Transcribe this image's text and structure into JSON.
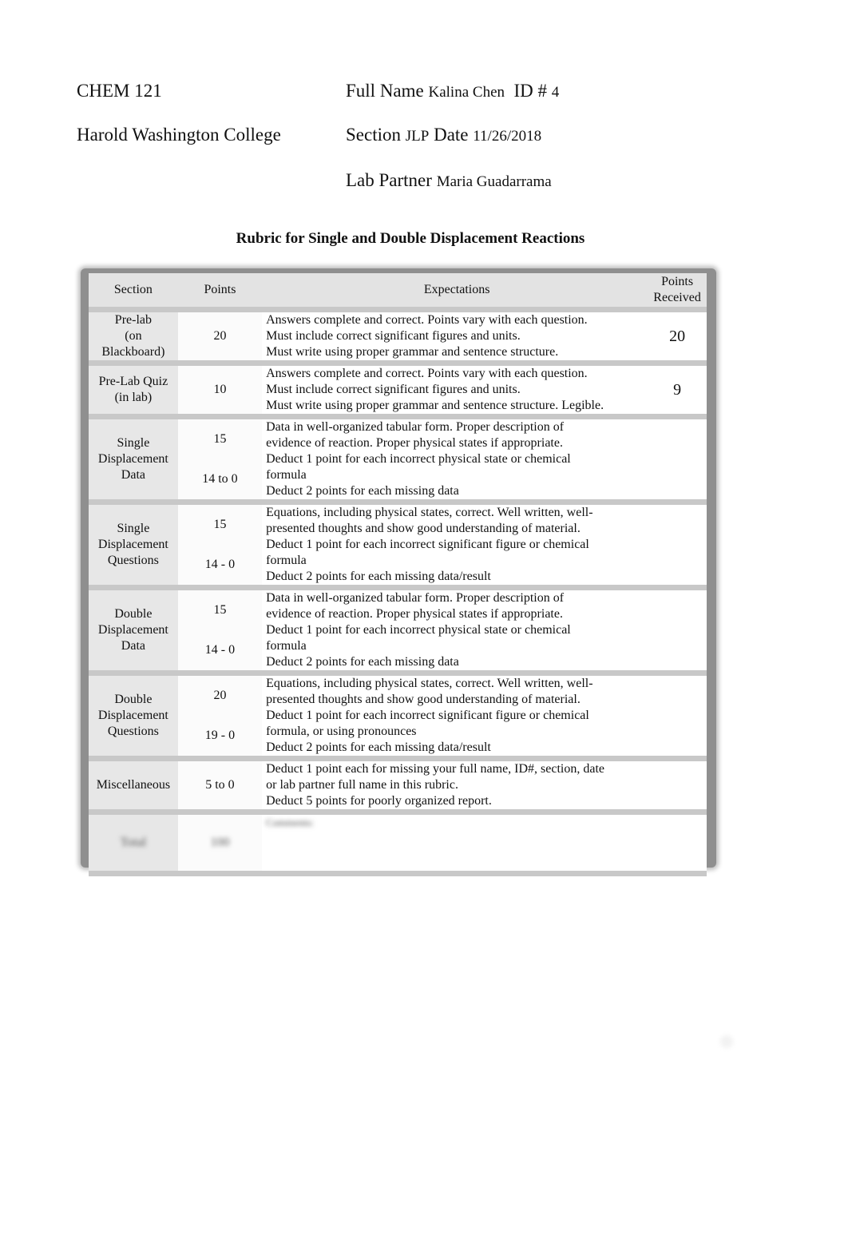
{
  "header": {
    "course": "CHEM 121",
    "college": "Harold Washington College",
    "full_name_label": "Full Name",
    "full_name_value": "Kalina Chen",
    "id_label": "ID #",
    "id_value": "4",
    "section_label": "Section",
    "section_value": "JLP",
    "date_label": "Date",
    "date_value": "11/26/2018",
    "lab_partner_label": "Lab Partner",
    "lab_partner_value": "Maria Guadarrama"
  },
  "title": "Rubric for Single and Double Displacement Reactions",
  "table": {
    "headers": {
      "section": "Section",
      "points": "Points",
      "expectations": "Expectations",
      "received_line1": "Points",
      "received_line2": "Received"
    },
    "rows": [
      {
        "section": [
          "Pre-lab",
          "(on",
          "Blackboard)"
        ],
        "points": [
          "20"
        ],
        "expectations": [
          "Answers complete and correct. Points vary with each question.",
          "Must include correct significant figures and units.",
          "Must write using proper grammar and sentence structure."
        ],
        "received": "20"
      },
      {
        "section": [
          "Pre-Lab Quiz",
          "(in lab)"
        ],
        "points": [
          "10"
        ],
        "expectations": [
          "Answers complete and correct.  Points vary with each question.",
          "Must include correct significant figures and units.",
          "Must write using proper grammar and sentence structure. Legible."
        ],
        "received": "9"
      },
      {
        "section": [
          "Single",
          "Displacement",
          "Data"
        ],
        "points": [
          "15",
          "14 to 0"
        ],
        "expectations": [
          "Data in well-organized tabular form. Proper description of",
          "evidence of reaction.  Proper physical states if appropriate.",
          "Deduct 1 point for each incorrect physical state or chemical",
          "formula",
          "Deduct 2 points for each missing data"
        ],
        "received": ""
      },
      {
        "section": [
          "Single",
          "Displacement",
          "Questions"
        ],
        "points": [
          "15",
          "14 - 0"
        ],
        "expectations": [
          "Equations, including physical states, correct.  Well written, well-",
          "presented thoughts and show good understanding of material.",
          "Deduct 1 point for each incorrect significant figure or chemical",
          "formula",
          "Deduct 2 points for each missing data/result"
        ],
        "received": ""
      },
      {
        "section": [
          "Double",
          "Displacement",
          "Data"
        ],
        "points": [
          "15",
          "14 - 0"
        ],
        "expectations": [
          "Data in well-organized tabular form. Proper description of",
          "evidence of reaction.  Proper physical states if appropriate.",
          "Deduct 1 point for each incorrect physical state or chemical",
          "formula",
          "Deduct 2 points for each missing data"
        ],
        "received": ""
      },
      {
        "section": [
          "Double",
          "Displacement",
          "Questions"
        ],
        "points": [
          "20",
          "19 - 0"
        ],
        "expectations": [
          "Equations, including physical states, correct.  Well written, well-",
          "presented thoughts and show good understanding of material.",
          "Deduct 1 point for each incorrect significant figure or chemical",
          "formula, or using pronounces",
          "Deduct 2 points for each missing data/result"
        ],
        "received": ""
      },
      {
        "section": [
          "Miscellaneous"
        ],
        "points": [
          "5 to 0"
        ],
        "expectations": [
          "Deduct 1 point each for missing your full name, ID#, section, date",
          "or lab partner full name in this rubric.",
          "Deduct 5 points for poorly organized report."
        ],
        "received": ""
      }
    ],
    "total_row": {
      "section": "Total",
      "points": "100",
      "expectations": "Comments:",
      "received": ""
    }
  }
}
